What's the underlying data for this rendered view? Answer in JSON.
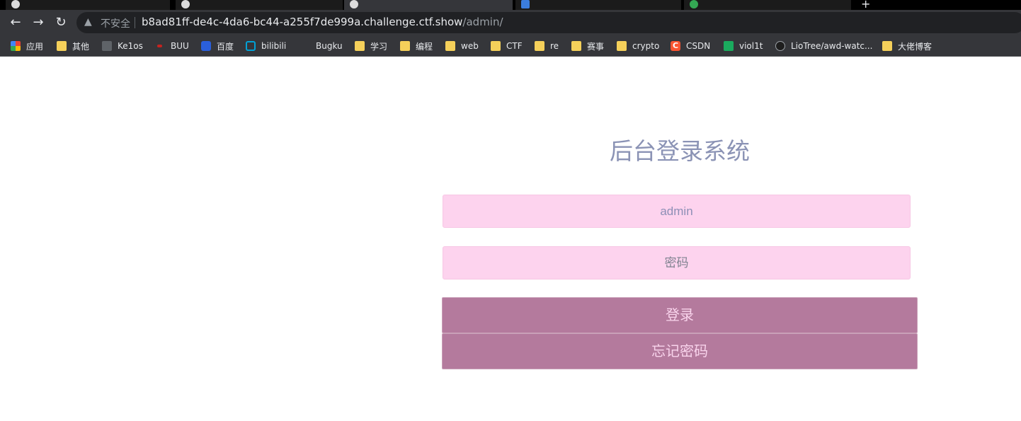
{
  "browser": {
    "url_host": "b8ad81ff-de4c-4da6-bc44-a255f7de999a.challenge.ctf.show",
    "url_path": "/admin/",
    "security_label": "不安全",
    "bookmarks": [
      {
        "label": "应用",
        "icon": "apps-grid-icon"
      },
      {
        "label": "其他",
        "icon": "folder-icon"
      },
      {
        "label": "Ke1os",
        "icon": "site-icon"
      },
      {
        "label": "BUU",
        "icon": "site-icon"
      },
      {
        "label": "百度",
        "icon": "baidu-icon"
      },
      {
        "label": "bilibili",
        "icon": "bilibili-icon"
      },
      {
        "label": "Bugku",
        "icon": "site-icon"
      },
      {
        "label": "学习",
        "icon": "folder-icon"
      },
      {
        "label": "编程",
        "icon": "folder-icon"
      },
      {
        "label": "web",
        "icon": "folder-icon"
      },
      {
        "label": "CTF",
        "icon": "folder-icon"
      },
      {
        "label": "re",
        "icon": "folder-icon"
      },
      {
        "label": "赛事",
        "icon": "folder-icon"
      },
      {
        "label": "crypto",
        "icon": "folder-icon"
      },
      {
        "label": "CSDN",
        "icon": "csdn-icon"
      },
      {
        "label": "viol1t",
        "icon": "site-icon"
      },
      {
        "label": "LioTree/awd-watc...",
        "icon": "github-icon"
      },
      {
        "label": "大佬博客",
        "icon": "folder-icon"
      }
    ]
  },
  "login": {
    "title": "后台登录系统",
    "username_value": "admin",
    "password_placeholder": "密码",
    "login_label": "登录",
    "forgot_label": "忘记密码"
  },
  "colors": {
    "title": "#8b93b5",
    "input_bg": "#fdd3ee",
    "button_bg": "#b47a9d",
    "button_text": "#f9d4ec"
  }
}
